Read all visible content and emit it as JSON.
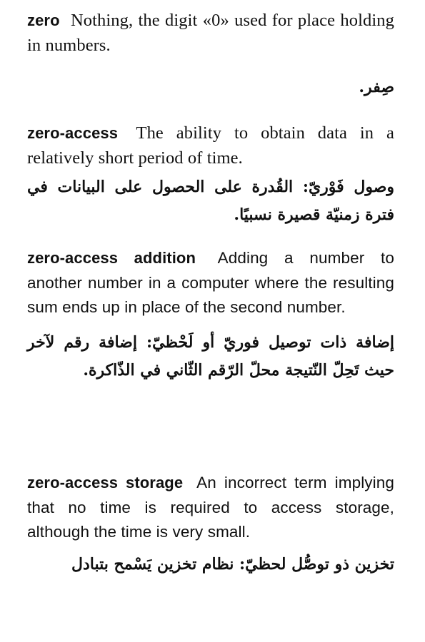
{
  "entries": [
    {
      "term": "zero",
      "definition": "Nothing, the digit «0» used for place holding in numbers.",
      "arabic": "صِفر."
    },
    {
      "term": "zero-access",
      "definition": "The ability to obtain data in a relatively short period of time.",
      "arabic": "وصول فَوْريّ: القُدرة على الحصول على البيانات في فترة زمنيّة قصيرة نسبيًا."
    },
    {
      "term": "zero-access addition",
      "definition": "Adding a number to another number in a computer where the resulting sum ends up in place of the second number.",
      "arabic": "إضافة ذات توصيل فوريّ أو لَحْظيّ: إضافة رقم لآخر حيث تَحِلّ النّتيجة محلّ الرّقم الثّاني في الذّاكرة."
    },
    {
      "term": "zero-access storage",
      "definition": "An incorrect term implying that no time is required to access storage, although the time is very small.",
      "arabic": "تخزين ذو توصُّل لحظيّ: نظام تخزين يَسْمح بتبادل"
    }
  ]
}
